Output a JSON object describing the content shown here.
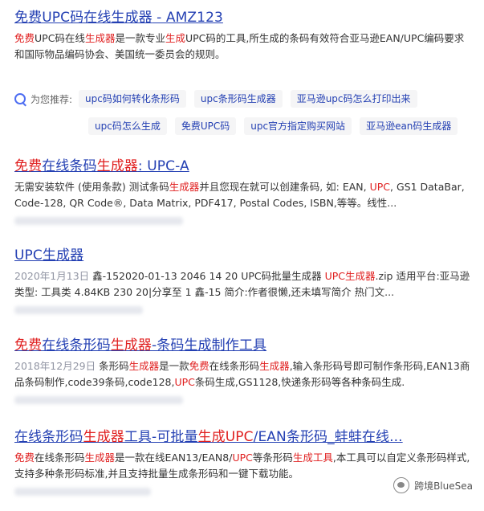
{
  "results": [
    {
      "title_parts": [
        {
          "text": "免费UPC码在线生成器",
          "hl": false
        },
        {
          "text": " - AMZ123",
          "hl": false
        }
      ],
      "desc_parts": [
        {
          "text": "免费",
          "hl": true
        },
        {
          "text": "UPC码在线",
          "hl": false
        },
        {
          "text": "生成器",
          "hl": true
        },
        {
          "text": "是一款专业",
          "hl": false
        },
        {
          "text": "生成",
          "hl": true
        },
        {
          "text": "UPC码的工具,所生成的条码有效符合亚马逊EAN/UPC编码要求和国际物品编码协会、美国统一委员会的规则。",
          "hl": false
        }
      ]
    },
    {
      "title_parts": [
        {
          "text": "免费",
          "hl": true
        },
        {
          "text": "在线条码",
          "hl": false
        },
        {
          "text": "生成器",
          "hl": true
        },
        {
          "text": ": UPC-A",
          "hl": false
        }
      ],
      "desc_parts": [
        {
          "text": "无需安装软件 (使用条款) 测试条码",
          "hl": false
        },
        {
          "text": "生成器",
          "hl": true
        },
        {
          "text": "并且您现在就可以创建条码, 如: EAN, ",
          "hl": false
        },
        {
          "text": "UPC",
          "hl": true
        },
        {
          "text": ", GS1 DataBar, Code-128, QR Code®, Data Matrix, PDF417, Postal Codes, ISBN,等等。线性...",
          "hl": false
        }
      ]
    },
    {
      "title_parts": [
        {
          "text": "UPC生成器",
          "hl": false
        }
      ],
      "date": "2020年1月13日",
      "desc_parts": [
        {
          "text": " 鑫-152020-01-13 2046 14 20 UPC码批量生成器 ",
          "hl": false
        },
        {
          "text": "UPC生成器",
          "hl": true
        },
        {
          "text": ".zip 适用平台:亚马逊类型: 工具类 4.84KB 230 20|分享至 1 鑫-15 简介:作者很懒,还未填写简介 热门文...",
          "hl": false
        }
      ]
    },
    {
      "title_parts": [
        {
          "text": "免费",
          "hl": true
        },
        {
          "text": "在线条形码",
          "hl": false
        },
        {
          "text": "生成器",
          "hl": true
        },
        {
          "text": "-条码生成制作工具",
          "hl": false
        }
      ],
      "date": "2018年12月29日",
      "desc_parts": [
        {
          "text": " 条形码",
          "hl": false
        },
        {
          "text": "生成器",
          "hl": true
        },
        {
          "text": "是一款",
          "hl": false
        },
        {
          "text": "免费",
          "hl": true
        },
        {
          "text": "在线条形码",
          "hl": false
        },
        {
          "text": "生成器",
          "hl": true
        },
        {
          "text": ",输入条形码号即可制作条形码,EAN13商品条码制作,code39条码,code128,",
          "hl": false
        },
        {
          "text": "UPC",
          "hl": true
        },
        {
          "text": "条码生成,GS1128,快递条形码等各种条码生成.",
          "hl": false
        }
      ]
    },
    {
      "title_parts": [
        {
          "text": "在线条形码",
          "hl": false
        },
        {
          "text": "生成器",
          "hl": true
        },
        {
          "text": "工具-可批量",
          "hl": false
        },
        {
          "text": "生成UPC",
          "hl": true
        },
        {
          "text": "/EAN条形码_蚌蚌在线...",
          "hl": false
        }
      ],
      "desc_parts": [
        {
          "text": "免费",
          "hl": true
        },
        {
          "text": "在线条形码",
          "hl": false
        },
        {
          "text": "生成器",
          "hl": true
        },
        {
          "text": "是一款在线EAN13/EAN8/",
          "hl": false
        },
        {
          "text": "UPC",
          "hl": true
        },
        {
          "text": "等条形码",
          "hl": false
        },
        {
          "text": "生成工具",
          "hl": true
        },
        {
          "text": ",本工具可以自定义条形码样式,支持多种条形码标准,并且支持批量生成条形码和一键下载功能。",
          "hl": false
        }
      ]
    }
  ],
  "recommend": {
    "label": "为您推荐:",
    "row1": [
      "upc码如何转化条形码",
      "upc条形码生成器",
      "亚马逊upc码怎么打印出来"
    ],
    "row2": [
      "upc码怎么生成",
      "免费UPC码",
      "upc官方指定购买网站",
      "亚马逊ean码生成器"
    ]
  },
  "watermark": {
    "text": "跨境BlueSea"
  }
}
